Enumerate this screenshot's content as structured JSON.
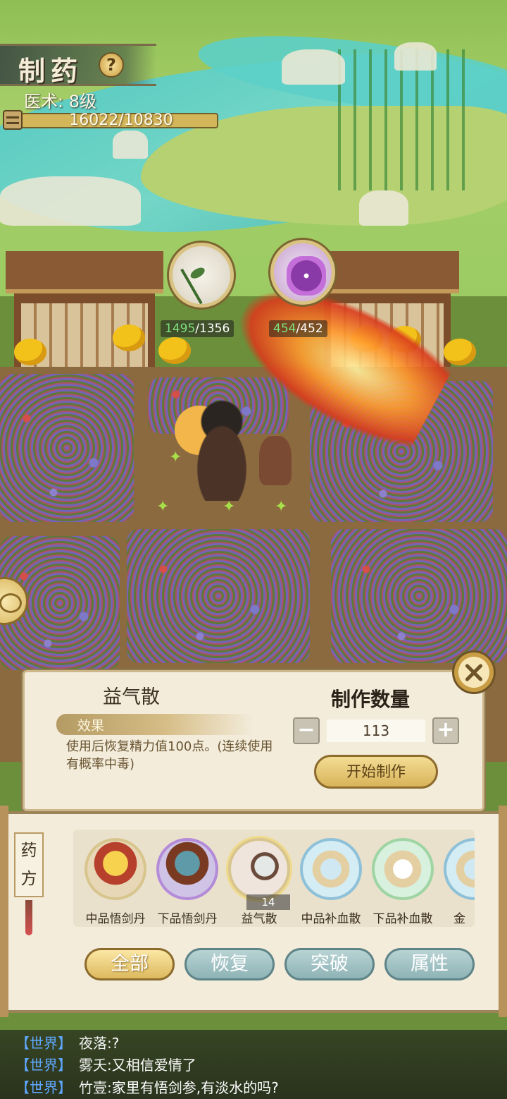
{
  "hud": {
    "title": "制药",
    "help": "?",
    "skill_label": "医术:",
    "skill_level": "8级",
    "exp_text": "16022/10830"
  },
  "herbs": [
    {
      "icon": "leaf-herb-icon",
      "owned": "1495",
      "required": "/1356"
    },
    {
      "icon": "purple-flower-icon",
      "owned": "454",
      "required": "/452"
    }
  ],
  "detail": {
    "name": "益气散",
    "effect_label": "效果",
    "effect_desc": "使用后恢复精力值100点。(连续使用有概率中毒)",
    "qty_title": "制作数量",
    "qty_value": "113",
    "minus": "−",
    "plus": "+",
    "start": "开始制作"
  },
  "recipe_list": {
    "label": "药方",
    "items": [
      {
        "name": "中品悟剑丹",
        "icon": "gold-pill-icon",
        "count": ""
      },
      {
        "name": "下品悟剑丹",
        "icon": "blue-pill-icon",
        "count": ""
      },
      {
        "name": "益气散",
        "icon": "vase-icon",
        "count": "14"
      },
      {
        "name": "中品补血散",
        "icon": "powder-icon",
        "count": ""
      },
      {
        "name": "下品补血散",
        "icon": "powder-icon",
        "count": ""
      },
      {
        "name": "金",
        "icon": "powder-icon",
        "count": ""
      }
    ],
    "filters": [
      "全部",
      "恢复",
      "突破",
      "属性"
    ],
    "active_filter": "全部"
  },
  "chat": [
    {
      "channel": "【世界】",
      "sender": "夜落:",
      "message": "?"
    },
    {
      "channel": "【世界】",
      "sender": "雾夭:",
      "message": "又相信爱情了"
    },
    {
      "channel": "【世界】",
      "sender": "竹壹:",
      "message": "家里有悟剑参,有淡水的吗?"
    }
  ],
  "colors": {
    "panel_bg": "#f3ecdb",
    "gold_button": "#d8b45a",
    "teal_button": "#8eb3b6",
    "chat_channel": "#5fa8ff",
    "enough_green": "#7ee07e"
  }
}
